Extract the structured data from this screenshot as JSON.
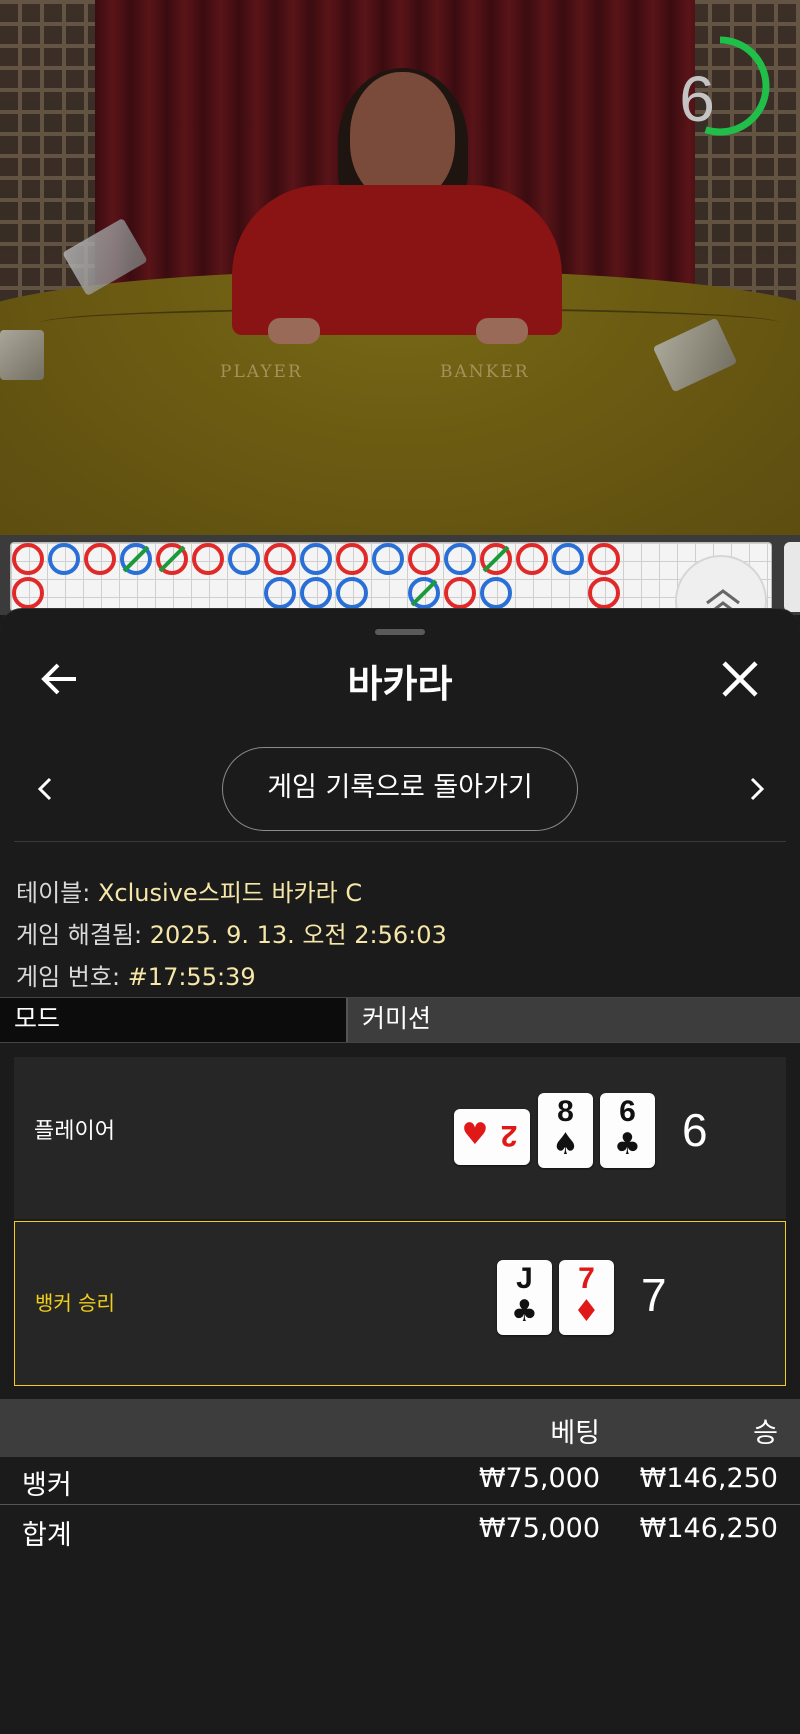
{
  "video": {
    "table_labels": {
      "player": "PLAYER",
      "banker": "BANKER"
    },
    "countdown": "6",
    "countdown_fraction": 0.55,
    "accent_green": "#1fbf4a"
  },
  "roadmap": {
    "row1": [
      "B",
      "P",
      "B",
      "P/T",
      "B/T",
      "B",
      "P",
      "B",
      "P",
      "B",
      "P",
      "B",
      "P",
      "B/T",
      "B",
      "P",
      "B"
    ],
    "row2": [
      "B",
      "",
      "",
      "",
      "",
      "",
      "",
      "P",
      "P",
      "P",
      "",
      "P/T",
      "B",
      "P",
      "",
      "",
      "B"
    ],
    "colors": {
      "banker": "#e02a2a",
      "player": "#2a6fd6",
      "tie": "#1c9a3a"
    }
  },
  "sheet": {
    "title": "바카라",
    "back_icon": "arrow-left-icon",
    "close_icon": "close-icon",
    "history_button": "게임 기록으로 돌아가기",
    "info": {
      "table_label": "테이블:",
      "table_value": "Xclusive스피드 바카라 C",
      "resolved_label": "게임 해결됨:",
      "resolved_value": "2025. 9. 13. 오전 2:56:03",
      "game_no_label": "게임 번호:",
      "game_no_value": "#17:55:39"
    },
    "mode": {
      "left": "모드",
      "right": "커미션"
    },
    "player": {
      "label": "플레이어",
      "score": "6",
      "cards": [
        {
          "rank": "2",
          "suit": "♥",
          "color": "red",
          "sideways": true
        },
        {
          "rank": "8",
          "suit": "♠",
          "color": "black",
          "sideways": false
        },
        {
          "rank": "6",
          "suit": "♣",
          "color": "black",
          "sideways": false
        }
      ]
    },
    "banker": {
      "label": "뱅커 승리",
      "score": "7",
      "winner_color": "#f0cf1a",
      "cards": [
        {
          "rank": "J",
          "suit": "♣",
          "color": "black",
          "sideways": false
        },
        {
          "rank": "7",
          "suit": "♦",
          "color": "red",
          "sideways": false
        }
      ]
    },
    "bets": {
      "headers": {
        "bet": "베팅",
        "win": "승"
      },
      "rows": [
        {
          "name": "뱅커",
          "bet": "₩75,000",
          "win": "₩146,250"
        },
        {
          "name": "합계",
          "bet": "₩75,000",
          "win": "₩146,250"
        }
      ]
    }
  }
}
